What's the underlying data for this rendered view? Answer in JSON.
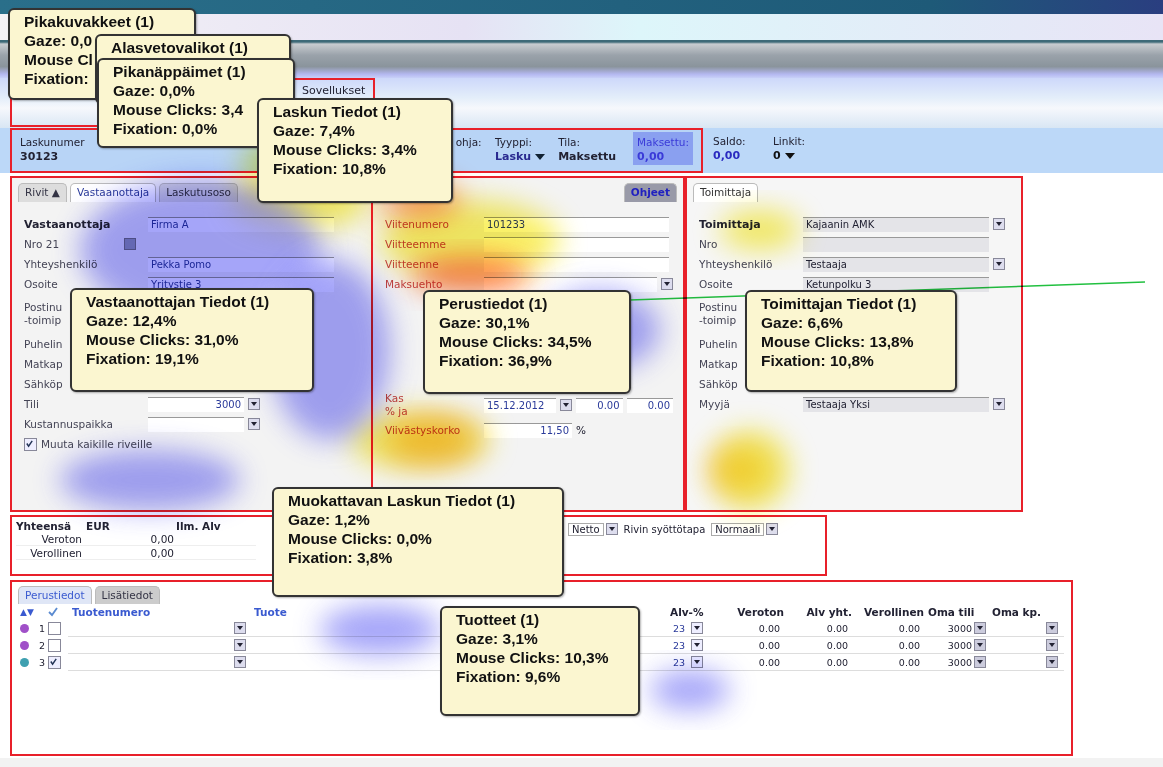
{
  "browser": {
    "tab": "Sovellukset"
  },
  "header": {
    "fields": [
      {
        "label": "Laskunumer",
        "value": "30123",
        "kind": "text"
      },
      {
        "label": "ohja:",
        "kind": "text"
      },
      {
        "label": "Tyyppi:",
        "value": "Lasku",
        "kind": "select"
      },
      {
        "label": "Tila:",
        "value": "Maksettu",
        "kind": "text"
      },
      {
        "label": "Maksettu:",
        "value": "0,00",
        "kind": "highlight"
      }
    ],
    "extra": [
      {
        "label": "Saldo:",
        "value": "0,00",
        "kind": "text"
      },
      {
        "label": "Linkit:",
        "value": "0",
        "kind": "select"
      }
    ]
  },
  "left_panel": {
    "tabs": [
      {
        "label": "Rivit ▲",
        "selected": false
      },
      {
        "label": "Vastaanottaja",
        "selected": true
      },
      {
        "label": "Laskutusoso",
        "selected": false
      }
    ],
    "rows": [
      {
        "label": "Vastaanottaja",
        "value": "Firma A",
        "kind": "title"
      },
      {
        "label": "Nro  21",
        "kind": "button"
      },
      {
        "label": "Yhteyshenkilö",
        "value": "Pekka Pomo",
        "kind": "field"
      },
      {
        "label": "Osoite",
        "value": "Yritystie 3",
        "kind": "field"
      },
      {
        "label": "Postinu",
        "sublabel": "-toimip",
        "kind": "label"
      },
      {
        "label": "Puhelin",
        "kind": "label"
      },
      {
        "label": "Matkap",
        "kind": "label"
      },
      {
        "label": "Sähköp",
        "kind": "label"
      },
      {
        "label": "Tili",
        "value": "3000",
        "kind": "select"
      },
      {
        "label": "Kustannuspaikka",
        "kind": "select"
      },
      {
        "label": "Muuta kaikille riveille",
        "kind": "check",
        "checked": true
      }
    ]
  },
  "middle_panel": {
    "tabs": [
      {
        "label": "Ohjeet",
        "selected": false
      }
    ],
    "rows": [
      {
        "label": "Viitenumero",
        "value": "101233",
        "kind": "field"
      },
      {
        "label": "Viitteemme",
        "kind": "field"
      },
      {
        "label": "Viitteenne",
        "kind": "field"
      },
      {
        "label": "Maksuehto",
        "kind": "select"
      }
    ],
    "lower_rows": [
      {
        "label": "Kas",
        "sublabel": "% ja",
        "values": [
          "15.12.2012",
          "0.00",
          "0.00"
        ],
        "kind": "discount"
      },
      {
        "label": "Viivästyskorko",
        "value": "11,50",
        "unit": "%",
        "kind": "rate"
      }
    ]
  },
  "right_panel": {
    "tabs": [
      {
        "label": "Toimittaja",
        "selected": true
      }
    ],
    "rows": [
      {
        "label": "Toimittaja",
        "value": "Kajaanin AMK",
        "kind": "title"
      },
      {
        "label": "Nro",
        "kind": "field"
      },
      {
        "label": "Yhteyshenkilö",
        "value": "Testaaja",
        "kind": "select"
      },
      {
        "label": "Osoite",
        "value": "Ketunpolku 3",
        "kind": "field"
      },
      {
        "label": "Postinu",
        "sublabel": "-toimip",
        "kind": "label"
      },
      {
        "label": "Puhelin",
        "kind": "label"
      },
      {
        "label": "Matkap",
        "kind": "label"
      },
      {
        "label": "Sähköp",
        "kind": "label"
      },
      {
        "label": "Myyjä",
        "value": "Testaaja Yksi",
        "kind": "select"
      }
    ]
  },
  "totals": {
    "columns": [
      "Yhteensä",
      "EUR",
      "Ilm. Alv"
    ],
    "rows": [
      [
        "Veroton",
        "0,00"
      ],
      [
        "Verollinen",
        "0,00"
      ]
    ],
    "mode": "Netto",
    "entry_label": "Rivin syöttötapa",
    "entry": "Normaali"
  },
  "products": {
    "tabs": [
      {
        "label": "Perustiedot",
        "selected": true
      },
      {
        "label": "Lisätiedot",
        "selected": false
      }
    ],
    "sort": "▲▼",
    "columns": [
      "Tuotenumero",
      "Tuote",
      "Alv-%",
      "Veroton",
      "Alv yht.",
      "Verollinen",
      "Oma tili",
      "Oma kp."
    ],
    "rows": [
      {
        "n": "1",
        "checked": false,
        "color": "#a050c8",
        "alv": "23",
        "veroton": "0.00",
        "alv_total": "0.00",
        "verollinen": "0.00",
        "account": "3000"
      },
      {
        "n": "2",
        "checked": false,
        "color": "#a050c8",
        "alv": "23",
        "veroton": "0.00",
        "alv_total": "0.00",
        "verollinen": "0.00",
        "account": "3000"
      },
      {
        "n": "3",
        "checked": true,
        "color": "#3fa0b0",
        "alv": "23",
        "veroton": "0.00",
        "alv_total": "0.00",
        "verollinen": "0.00",
        "account": "3000"
      }
    ]
  },
  "tooltips": [
    {
      "title": "Pikakuvakkeet (1)",
      "lines": [
        "Gaze: 0,0",
        "Mouse Cl",
        "Fixation:"
      ]
    },
    {
      "title": "Alasvetovalikot (1)"
    },
    {
      "title": "Pikanäppäimet (1)",
      "lines": [
        "Gaze: 0,0%",
        "Mouse Clicks: 3,4",
        "Fixation: 0,0%"
      ]
    },
    {
      "title": "Laskun Tiedot (1)",
      "lines": [
        "Gaze: 7,4%",
        "Mouse Clicks: 3,4%",
        "Fixation: 10,8%"
      ]
    },
    {
      "title": "Vastaanottajan Tiedot (1)",
      "lines": [
        "Gaze: 12,4%",
        "Mouse Clicks: 31,0%",
        "Fixation: 19,1%"
      ]
    },
    {
      "title": "Perustiedot (1)",
      "lines": [
        "Gaze: 30,1%",
        "Mouse Clicks: 34,5%",
        "Fixation: 36,9%"
      ]
    },
    {
      "title": "Toimittajan Tiedot (1)",
      "lines": [
        "Gaze: 6,6%",
        "Mouse Clicks: 13,8%",
        "Fixation: 10,8%"
      ]
    },
    {
      "title": "Muokattavan Laskun Tiedot (1)",
      "lines": [
        "Gaze: 1,2%",
        "Mouse Clicks: 0,0%",
        "Fixation: 3,8%"
      ]
    },
    {
      "title": "Tuotteet (1)",
      "lines": [
        "Gaze: 3,1%",
        "Mouse Clicks: 10,3%",
        "Fixation: 9,6%"
      ]
    }
  ]
}
